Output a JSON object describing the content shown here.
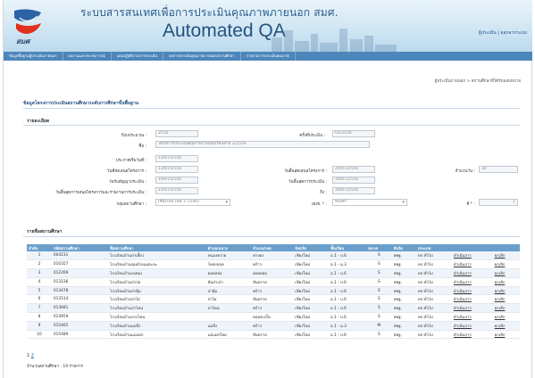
{
  "header": {
    "title_th": "ระบบสารสนเทศเพื่อการประเมินคุณภาพภายนอก สมศ.",
    "title_en": "Automated QA",
    "logo_text": "สมศ",
    "user_text": "ผู้ประเมิน | ออกจากระบบ"
  },
  "nav": {
    "items": [
      "ข้อมูลพื้นฐานผู้ประเมินภายนอก",
      "ผลงานและประสบการณ์",
      "แผนปฏิบัติงานการประเมิน",
      "ผลการประเมินคุณภาพภายนอกสถานศึกษา",
      "รายงานการประเมินคุณภาพ"
    ]
  },
  "breadcrumb": "ผู้ประเมินภายนอก > สถานศึกษาที่ได้รับมอบหมาย",
  "page_title": "ข้อมูลโครงการประเมินสถานศึกษาระดับการศึกษาขั้นพื้นฐาน",
  "details": {
    "section": "รายละเอียด",
    "year_label": "ปีงบประมาณ :",
    "year_value": "2556",
    "round_label": "ครั้งที่ประเมิน :",
    "round_value": "02/2556",
    "name_label": "ชื่อ :",
    "name_value": "โครงการประเมินคุณภาพภายนอกรอบสาม 2/2556",
    "start_label": "ประกาศเริ่มวันที่ :",
    "start_value": "13/07/2556",
    "submit_label": "วันที่ส่งเสนอโครงการ :",
    "submit_value": "13/07/2556",
    "approve_label": "วันสิ้นสุดเสนอโครงการ :",
    "approve_value": "20/07/2556",
    "count_label": "จำนวนวัน :",
    "count_value": "30",
    "contract_label": "วันรับสัญญาประเมิน :",
    "contract_value": "19/07/2556",
    "contract_end_label": "วันสิ้นสุดการประเมิน :",
    "contract_end_value": "16/07/2556",
    "report_label": "วันสิ้นสุดการเสนอโครงการและรายงานการประเมิน :",
    "report_value": "15/07/2556",
    "to_label": "ถึง :",
    "to_value": "30/07/2556",
    "group_label": "กลุ่มสถานศึกษา :",
    "group_value": "เชียงใหม่ เขต 1 (1/46)",
    "team_label": "ผมช. * :",
    "team_value": "ทองคำ",
    "no_label": "ที่ * :",
    "no_value": "1"
  },
  "schools": {
    "section": "รายชื่อสถานศึกษา",
    "columns": [
      "ลำดับ",
      "รหัสสถานศึกษา",
      "ชื่อสถานศึกษา",
      "ตำบล/แขวง",
      "อำเภอ/เขต",
      "จังหวัด",
      "ชั้นเรียน",
      "ขนาด",
      "สังกัด",
      "ประเภท",
      "",
      ""
    ],
    "rows": [
      [
        "1",
        "004231",
        "โรงเรียนบ้านป่าเสี้ยว",
        "หนองควาย",
        "หางดง",
        "เชียงใหม่",
        "อ.1 - ป.6",
        "S",
        "สพฐ.",
        "ทก.ทั่วไป",
        "ดำเนินการ",
        "ยกเลิก"
      ],
      [
        "2",
        "010357",
        "โรงเรียนบ้านขุนห้วยแม่ตะละ",
        "โหล่งขอด",
        "พร้าว",
        "เชียงใหม่",
        "อ.1 - ม.3",
        "S",
        "สพฐ.",
        "ทก.ทั่วไป",
        "ดำเนินการ",
        "ยกเลิก"
      ],
      [
        "3",
        "012269",
        "โรงเรียนบ้านปงตอง",
        "ดอยหล่อ",
        "ดอยหล่อ",
        "เชียงใหม่",
        "อ.1 - ป.6",
        "S",
        "สพฐ.",
        "ทก.ทั่วไป",
        "ดำเนินการ",
        "ยกเลิก"
      ],
      [
        "4",
        "013236",
        "โรงเรียนบ้านป่าก่อ",
        "สันป่าเป๋า",
        "สันทราย",
        "เชียงใหม่",
        "อ.1 - ป.6",
        "S",
        "สพฐ.",
        "ทก.ทั่วไป",
        "ดำเนินการ",
        "ยกเลิก"
      ],
      [
        "5",
        "013478",
        "โรงเรียนบ้านป่าตุ้ม",
        "ป่าตุ้ม",
        "พร้าว",
        "เชียงใหม่",
        "อ.1 - ป.6",
        "S",
        "สพฐ.",
        "ทก.ทั่วไป",
        "ดำเนินการ",
        "ยกเลิก"
      ],
      [
        "6",
        "013514",
        "โรงเรียนบ้านป่าไผ่",
        "ป่าไผ่",
        "สันทราย",
        "เชียงใหม่",
        "อ.1 - ป.6",
        "S",
        "สพฐ.",
        "ทก.ทั่วไป",
        "ดำเนินการ",
        "ยกเลิก"
      ],
      [
        "7",
        "013681",
        "โรงเรียนบ้านป่าไหน่",
        "ป่าไหน่",
        "พร้าว",
        "เชียงใหม่",
        "อ.1 - ป.6",
        "S",
        "สพฐ.",
        "ทก.ทั่วไป",
        "ดำเนินการ",
        "ยกเลิก"
      ],
      [
        "8",
        "014959",
        "โรงเรียนบ้านปางโทน",
        "",
        "ดอยสะเก็ด",
        "เชียงใหม่",
        "อ.1 - ป.6",
        "S",
        "สพฐ.",
        "ทก.ทั่วไป",
        "ดำเนินการ",
        "ยกเลิก"
      ],
      [
        "9",
        "015465",
        "โรงเรียนบ้านแม่ปั๋ง",
        "แม่ปั๋ง",
        "พร้าว",
        "เชียงใหม่",
        "อ.1 - ม.3",
        "M",
        "สพฐ.",
        "ทก.ทั่วไป",
        "ดำเนินการ",
        "ยกเลิก"
      ],
      [
        "10",
        "015489",
        "โรงเรียนบ้านแม่แฝก",
        "แม่แฝกใหม่",
        "สันทราย",
        "เชียงใหม่",
        "อ.1 - ป.6",
        "S",
        "สพฐ.",
        "ทก.ทั่วไป",
        "ดำเนินการ",
        "ยกเลิก"
      ]
    ]
  },
  "pager": {
    "current": "1",
    "next": "2"
  },
  "total_text": "จำนวนสถานศึกษา : 19 รายการ"
}
